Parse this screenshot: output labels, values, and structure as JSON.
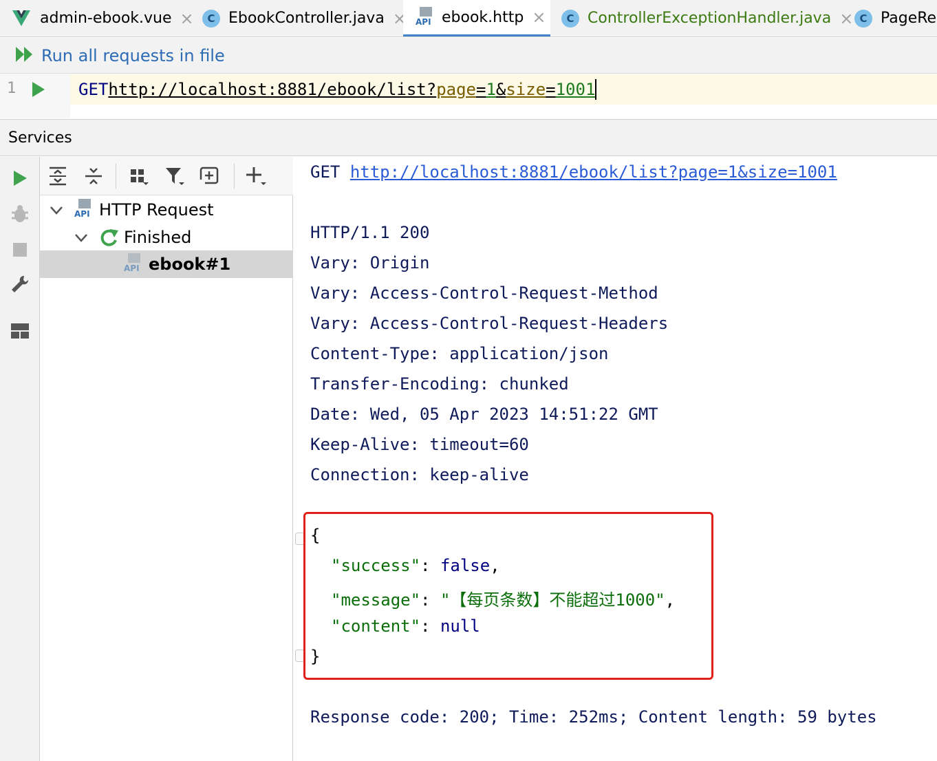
{
  "tabs": [
    {
      "label": "admin-ebook.vue",
      "icon": "vue-icon",
      "active": false
    },
    {
      "label": "EbookController.java",
      "icon": "java-class-icon",
      "active": false
    },
    {
      "label": "ebook.http",
      "icon": "api-file-icon",
      "active": true
    },
    {
      "label": "ControllerExceptionHandler.java",
      "icon": "java-class-icon",
      "active": false
    },
    {
      "label": "PageReq",
      "icon": "java-class-icon",
      "active": false
    }
  ],
  "tab_icon_letter": "C",
  "api_icon_label": "API",
  "run_bar": {
    "label": "Run all requests in file"
  },
  "editor": {
    "line_number": "1",
    "method": "GET",
    "url_base": "http://localhost:8881/ebook/list?",
    "param1_name": "page",
    "param1_value": "1",
    "param2_name": "size",
    "param2_value": "1001",
    "eq": "=",
    "amp": "&"
  },
  "services": {
    "title": "Services"
  },
  "tree": {
    "root": "HTTP Request",
    "group": "Finished",
    "item": "ebook#1"
  },
  "response": {
    "request_method": "GET",
    "request_url": "http://localhost:8881/ebook/list?page=1&size=1001",
    "status": "HTTP/1.1 200",
    "headers": [
      "Vary: Origin",
      "Vary: Access-Control-Request-Method",
      "Vary: Access-Control-Request-Headers",
      "Content-Type: application/json",
      "Transfer-Encoding: chunked",
      "Date: Wed, 05 Apr 2023 14:51:22 GMT",
      "Keep-Alive: timeout=60",
      "Connection: keep-alive"
    ],
    "json": {
      "open": "{",
      "close": "}",
      "success_key": "\"success\"",
      "success_val": "false",
      "message_key": "\"message\"",
      "message_val": "\"【每页条数】不能超过1000\"",
      "content_key": "\"content\"",
      "content_val": "null",
      "colon": ": ",
      "comma": ","
    },
    "summary": "Response code: 200; Time: 252ms; Content length: 59 bytes"
  },
  "colors": {
    "accent": "#4083c9",
    "run_green": "#3fa34d",
    "highlight_red": "#e0201a",
    "link_blue": "#2a5bd7"
  }
}
